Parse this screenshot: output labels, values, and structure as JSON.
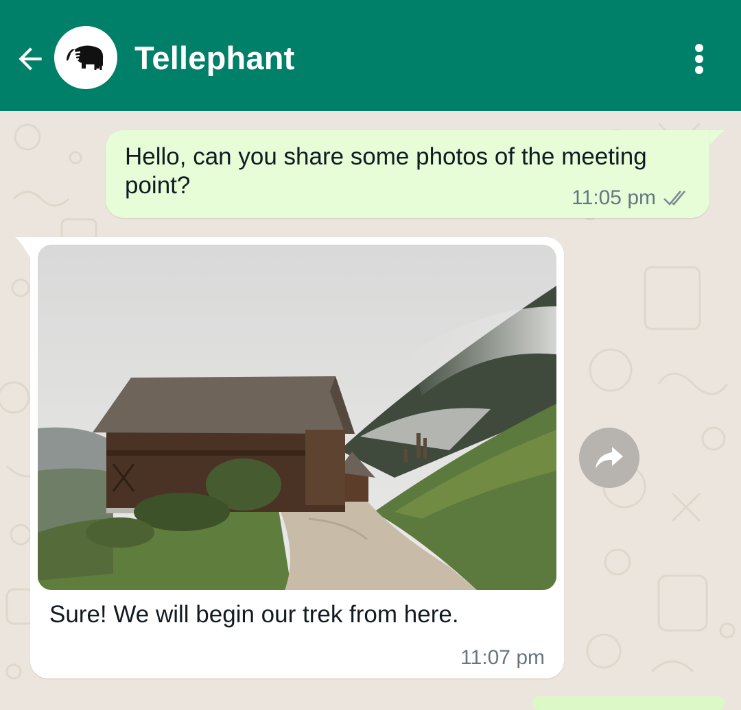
{
  "header": {
    "title": "Tellephant",
    "back_icon": "arrow-left-icon",
    "avatar_icon": "elephant-logo-icon",
    "menu_icon": "more-vertical-icon",
    "color": "#008069"
  },
  "messages": [
    {
      "direction": "outgoing",
      "text": "Hello, can you share some photos of the meeting point?",
      "time": "11:05 pm",
      "status_icon": "double-check-icon",
      "bubble_color": "#e6fdd8"
    },
    {
      "direction": "incoming",
      "image": "photo of a wooden barn beside a dirt road on a misty green hillside",
      "text": "Sure! We will begin our trek from here.",
      "time": "11:07 pm",
      "bubble_color": "#ffffff"
    }
  ],
  "forward_icon": "forward-share-icon",
  "colors": {
    "chat_background": "#ece5dd",
    "meta_text": "#667781"
  }
}
